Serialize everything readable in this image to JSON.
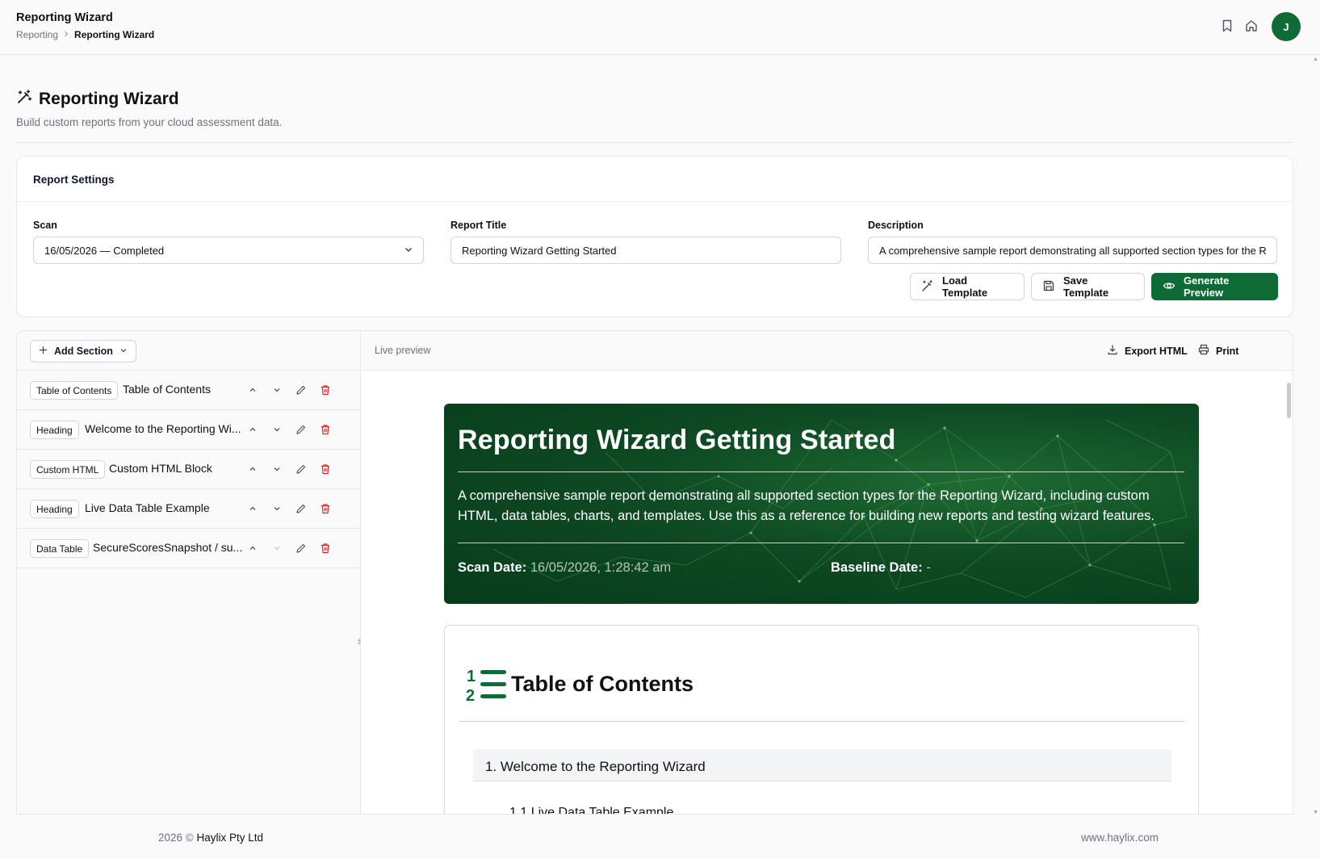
{
  "topbar": {
    "title": "Reporting Wizard",
    "breadcrumb": [
      "Reporting",
      "Reporting Wizard"
    ],
    "avatar_initial": "J"
  },
  "page": {
    "title": "Reporting Wizard",
    "subtitle": "Build custom reports from your cloud assessment data."
  },
  "settings": {
    "card_title": "Report Settings",
    "scan_label": "Scan",
    "scan_value": "16/05/2026 — Completed",
    "title_label": "Report Title",
    "title_value": "Reporting Wizard Getting Started",
    "description_label": "Description",
    "description_value": "A comprehensive sample report demonstrating all supported section types for the R",
    "load_template": "Load Template",
    "save_template": "Save Template",
    "generate_preview": "Generate Preview"
  },
  "sections_panel": {
    "add_section": "Add Section",
    "rows": [
      {
        "tag": "Table of Contents",
        "name": "Table of Contents"
      },
      {
        "tag": "Heading",
        "name": "Welcome to the Reporting Wi..."
      },
      {
        "tag": "Custom HTML",
        "name": "Custom HTML Block"
      },
      {
        "tag": "Heading",
        "name": "Live Data Table Example"
      },
      {
        "tag": "Data Table",
        "name": "SecureScoresSnapshot / su..."
      }
    ]
  },
  "preview": {
    "label": "Live preview",
    "export_html": "Export HTML",
    "print": "Print",
    "hero_title": "Reporting Wizard Getting Started",
    "hero_description": "A comprehensive sample report demonstrating all supported section types for the Reporting Wizard, including custom HTML, data tables, charts, and templates. Use this as a reference for building new reports and testing wizard features.",
    "scan_date_label": "Scan Date:",
    "scan_date_value": "16/05/2026, 1:28:42 am",
    "baseline_label": "Baseline Date:",
    "baseline_value": "-",
    "toc_title": "Table of Contents",
    "toc_item_1": "1. Welcome to the Reporting Wizard",
    "toc_item_2": "1.1 Live Data Table Example",
    "accent_color": "#0f6b36"
  },
  "footer": {
    "year": "2026 ©",
    "company": "Haylix Pty Ltd",
    "website": "www.haylix.com"
  }
}
